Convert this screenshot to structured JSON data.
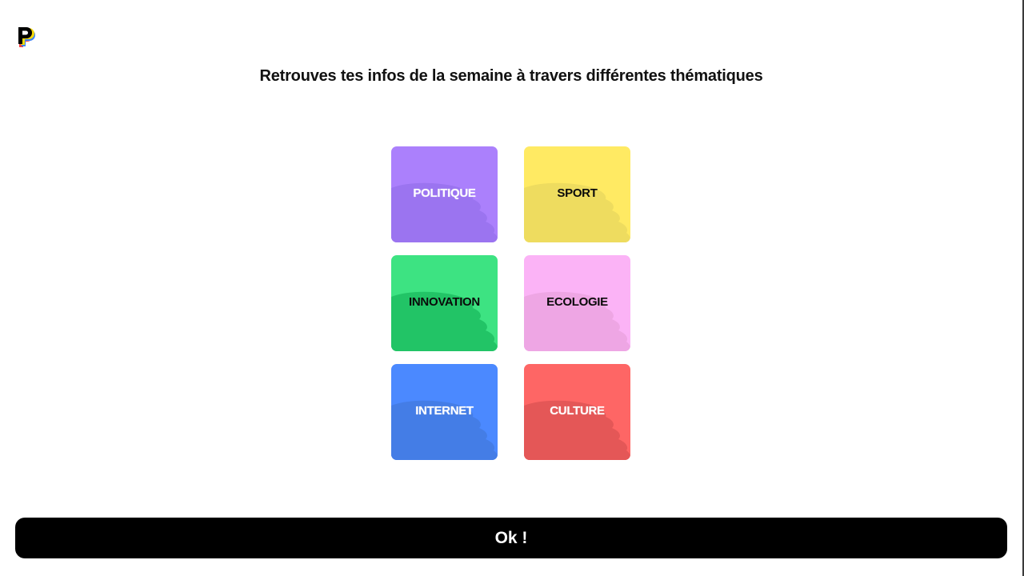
{
  "logo": {
    "icon": "p-logo-icon",
    "colors": [
      "#000000",
      "#f5d90a",
      "#3b82f6",
      "#ef4444"
    ]
  },
  "headline": "Retrouves tes infos de la semaine à travers différentes thématiques",
  "topics": [
    {
      "label": "POLITIQUE",
      "color": "#ab80fc",
      "shade": "#9b74f0",
      "text": "light"
    },
    {
      "label": "SPORT",
      "color": "#ffea63",
      "shade": "#eedc5f",
      "text": "dark"
    },
    {
      "label": "INNOVATION",
      "color": "#3de382",
      "shade": "#22c466",
      "text": "dark"
    },
    {
      "label": "ECOLOGIE",
      "color": "#fbb3f6",
      "shade": "#eea6e4",
      "text": "dark"
    },
    {
      "label": "INTERNET",
      "color": "#4b89ff",
      "shade": "#447de6",
      "text": "light"
    },
    {
      "label": "CULTURE",
      "color": "#fe6665",
      "shade": "#e45757",
      "text": "light"
    }
  ],
  "ok_button": {
    "label": "Ok !"
  }
}
